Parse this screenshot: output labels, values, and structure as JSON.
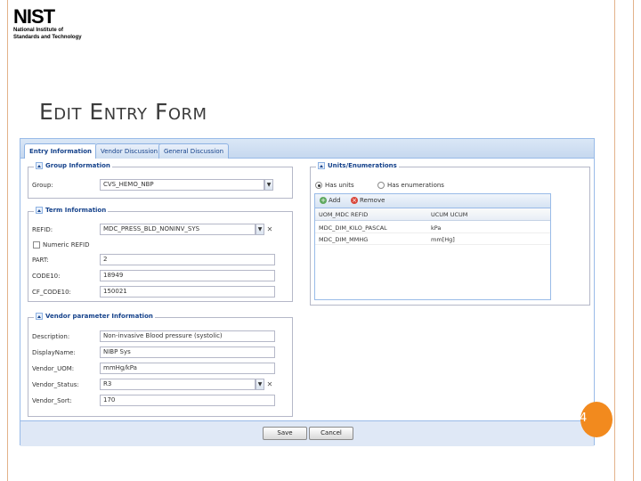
{
  "logo": {
    "word": "NIST",
    "line1": "National Institute of",
    "line2": "Standards and Technology"
  },
  "slide": {
    "title": "Edit Entry Form",
    "page_number": "4"
  },
  "tabs": [
    "Entry Information",
    "Vendor Discussion",
    "General Discussion"
  ],
  "group_info": {
    "legend": "Group Information",
    "group_label": "Group:",
    "group_value": "CVS_HEMO_NBP"
  },
  "term_info": {
    "legend": "Term Information",
    "refid_label": "REFID:",
    "refid_value": "MDC_PRESS_BLD_NONINV_SYS",
    "checkbox_label": "Numeric REFID",
    "partition_label": "PART:",
    "partition_value": "2",
    "code10_label": "CODE10:",
    "code10_value": "18949",
    "cfcode10_label": "CF_CODE10:",
    "cfcode10_value": "150021"
  },
  "vendor_info": {
    "legend": "Vendor parameter Information",
    "description_label": "Description:",
    "description_value": "Non-invasive Blood pressure (systolic)",
    "displayname_label": "DisplayName:",
    "displayname_value": "NIBP Sys",
    "vendor_uom_label": "Vendor_UOM:",
    "vendor_uom_value": "mmHg/kPa",
    "vendor_status_label": "Vendor_Status:",
    "vendor_status_value": "R3",
    "vendor_sort_label": "Vendor_Sort:",
    "vendor_sort_value": "170"
  },
  "units": {
    "legend": "Units/Enumerations",
    "radio_units": "Has units",
    "radio_enums": "Has enumerations",
    "add_label": "Add",
    "remove_label": "Remove",
    "columns": [
      "UOM_MDC REFID",
      "UCUM UCUM"
    ],
    "rows": [
      [
        "MDC_DIM_KILO_PASCAL",
        "kPa"
      ],
      [
        "MDC_DIM_MMHG",
        "mm[Hg]"
      ]
    ]
  },
  "footer": {
    "save_label": "Save",
    "cancel_label": "Cancel"
  },
  "colors": {
    "accent": "#f28a1e",
    "frame": "#e3b28a",
    "extjs_border": "#99bbe8",
    "extjs_text": "#15428b"
  }
}
